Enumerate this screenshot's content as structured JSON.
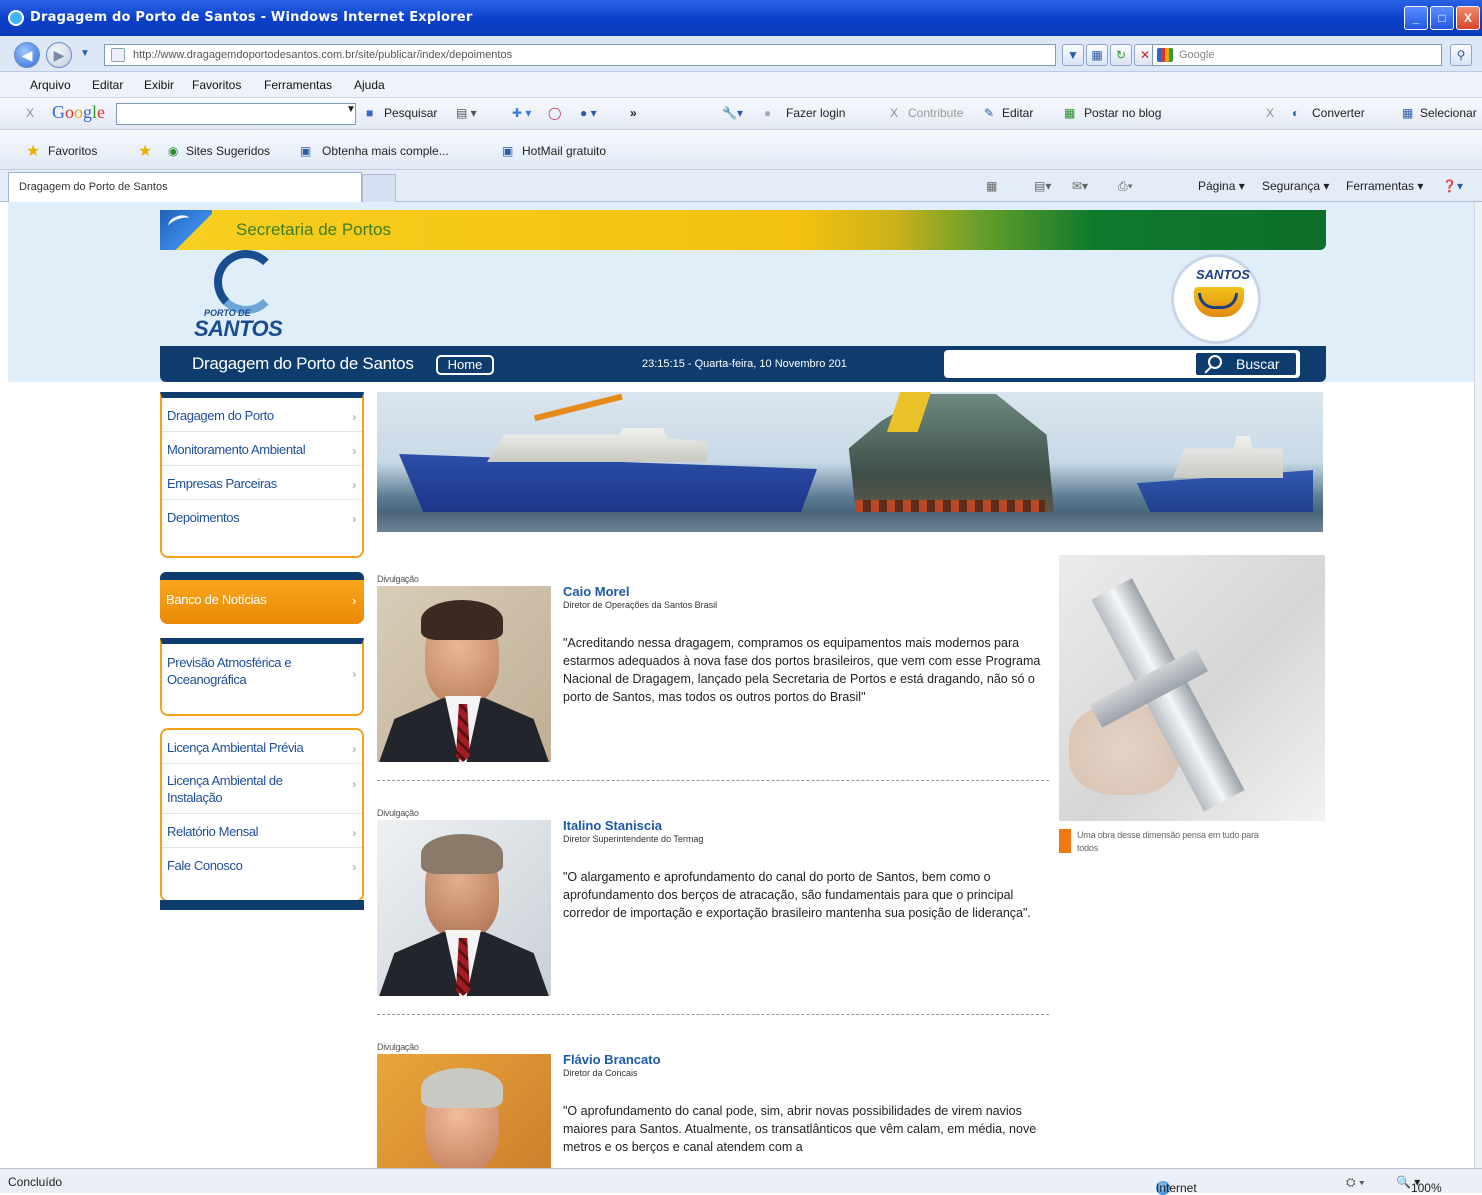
{
  "window": {
    "title": "Dragagem do Porto de Santos - Windows Internet Explorer",
    "min": "_",
    "max": "□",
    "close": "X"
  },
  "address": {
    "url": "http://www.dragagemdoportodesantos.com.br/site/publicar/index/depoimentos",
    "search_placeholder": "Google"
  },
  "menu": [
    "Arquivo",
    "Editar",
    "Exibir",
    "Favoritos",
    "Ferramentas",
    "Ajuda"
  ],
  "google_toolbar": {
    "close": "X",
    "logo": [
      "G",
      "o",
      "o",
      "g",
      "l",
      "e"
    ],
    "search_btn": "Pesquisar",
    "more": "»",
    "login": "Fazer login",
    "close2": "X",
    "contribute": "Contribute",
    "edit": "Editar",
    "post": "Postar no blog",
    "close3": "X",
    "convert": "Converter",
    "select": "Selecionar"
  },
  "favorites_bar": {
    "favorites": "Favoritos",
    "suggested": "Sites Sugeridos",
    "get_more": "Obtenha mais comple...",
    "hotmail": "HotMail gratuito"
  },
  "tabs": {
    "active": "Dragagem do Porto de Santos",
    "page_menu": "Página",
    "security_menu": "Segurança",
    "tools_menu": "Ferramentas"
  },
  "site": {
    "banner": "Secretaria de Portos",
    "logo_small": "PORTO DE",
    "logo_big": "SANTOS",
    "seal_text": "SANTOS",
    "nav_title": "Dragagem do Porto de Santos",
    "home": "Home",
    "datetime": "23:15:15 - Quarta-feira, 10 Novembro 201",
    "search_btn": "Buscar"
  },
  "sidebar": {
    "group1": [
      {
        "label": "Dragagem do Porto"
      },
      {
        "label": "Monitoramento Ambiental"
      },
      {
        "label": "Empresas Parceiras"
      },
      {
        "label": "Depoimentos"
      }
    ],
    "news": "Banco de Notícias",
    "forecast": "Previsão Atmosférica e Oceanográfica",
    "group3": [
      {
        "label": "Licença Ambiental Prévia"
      },
      {
        "label": "Licença Ambiental de Instalação"
      },
      {
        "label": "Relatório Mensal"
      },
      {
        "label": "Fale Conosco"
      }
    ]
  },
  "testimonials": [
    {
      "credit": "Divulgação",
      "name": "Caio Morel",
      "role": "Diretor de Operações da Santos Brasil",
      "quote": "\"Acreditando nessa dragagem, compramos os equipamentos mais modernos para estarmos adequados à nova fase dos portos brasileiros, que vem com esse Programa Nacional de Dragagem, lançado pela Secretaria de Portos e está dragando, não só o porto de Santos, mas todos os outros portos do Brasil\""
    },
    {
      "credit": "Divulgação",
      "name": "Italino Staniscia",
      "role": "Diretor Superintendente do Termag",
      "quote": "\"O alargamento e aprofundamento do canal do porto de Santos, bem como o aprofundamento dos berços de atracação, são fundamentais para que o principal corredor de importação e exportação brasileiro mantenha sua posição de liderança\"."
    },
    {
      "credit": "Divulgação",
      "name": "Flávio Brancato",
      "role": "Diretor da Concais",
      "quote": "\"O aprofundamento do canal pode, sim, abrir novas possibilidades de virem navios maiores para Santos. Atualmente, os transatlânticos que vêm calam, em média, nove metros e os berços e canal atendem com a"
    }
  ],
  "right_caption": "Uma obra desse dimensão pensa em tudo para todos",
  "status": {
    "left": "Concluído",
    "zone": "Internet",
    "zoom": "100%"
  },
  "colors": {
    "nav_blue": "#0f3c6e",
    "accent_orange": "#f4a21a",
    "link_blue": "#1d5aa8"
  }
}
